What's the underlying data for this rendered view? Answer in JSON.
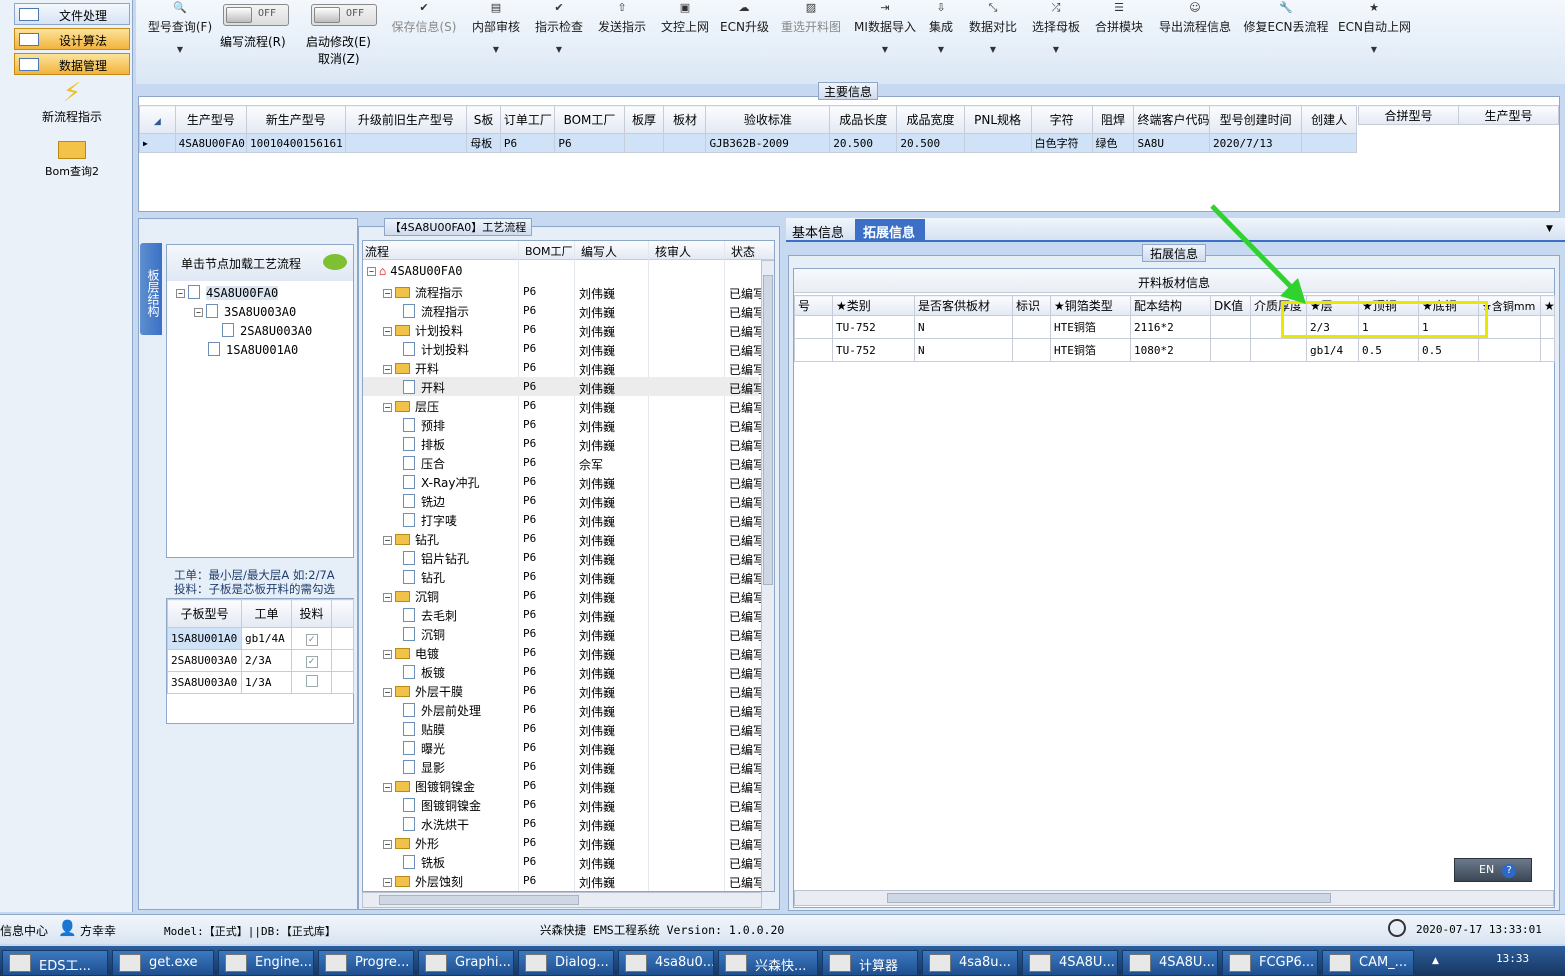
{
  "nav": {
    "items": [
      {
        "label": "文件处理"
      },
      {
        "label": "设计算法"
      },
      {
        "label": "数据管理"
      }
    ],
    "actions": [
      {
        "label": "新流程指示",
        "icon": "lightning-icon"
      },
      {
        "label": "Bom查询2",
        "icon": "open-folder-icon"
      }
    ]
  },
  "toolbar": {
    "buttons": [
      {
        "label": "型号查询(F)",
        "icon": "search-icon"
      },
      {
        "label": "保存信息(S)",
        "icon": "check-icon"
      },
      {
        "label": "内部审核",
        "icon": "printer-icon"
      },
      {
        "label": "指示检查",
        "icon": "check-icon"
      },
      {
        "label": "发送指示",
        "icon": "upload-icon"
      },
      {
        "label": "文控上网",
        "icon": "stamp-icon"
      },
      {
        "label": "ECN升级",
        "icon": "cloud-icon"
      },
      {
        "label": "重选开料图",
        "icon": "image-icon"
      },
      {
        "label": "MI数据导入",
        "icon": "import-icon"
      },
      {
        "label": "集成",
        "icon": "download-icon"
      },
      {
        "label": "数据对比",
        "icon": "compare-icon"
      },
      {
        "label": "选择母板",
        "icon": "shuffle-icon"
      },
      {
        "label": "合拼模块",
        "icon": "list-icon"
      },
      {
        "label": "导出流程信息",
        "icon": "smile-icon"
      },
      {
        "label": "修复ECN丢流程",
        "icon": "wrench-icon"
      },
      {
        "label": "ECN自动上网",
        "icon": "star-icon"
      }
    ],
    "toggles": [
      {
        "state": "OFF",
        "label": "编写流程(R)"
      },
      {
        "state": "OFF",
        "label": "启动修改(E)",
        "sub": "取消(Z)"
      }
    ]
  },
  "main_info": {
    "title": "主要信息",
    "columns": [
      "生产型号",
      "新生产型号",
      "升级前旧生产型号",
      "S板",
      "订单工厂",
      "BOM工厂",
      "板厚",
      "板材",
      "验收标准",
      "成品长度",
      "成品宽度",
      "PNL规格",
      "字符",
      "阻焊",
      "终端客户代码",
      "型号创建时间",
      "创建人"
    ],
    "row": [
      "4SA8U00FA0",
      "10010400156161",
      "",
      "母板",
      "P6",
      "P6",
      "",
      "",
      "GJB362B-2009",
      "20.500",
      "20.500",
      "",
      "白色字符",
      "绿色",
      "SA8U",
      "2020/7/13",
      ""
    ],
    "side_columns": [
      "合拼型号",
      "生产型号"
    ]
  },
  "left": {
    "vertical_tab": "板层结构",
    "hint": "单击节点加载工艺流程",
    "tree": [
      "4SA8U00FA0",
      "3SA8U003A0",
      "2SA8U003A0",
      "1SA8U001A0"
    ],
    "note1": "工单：最小层/最大层A 如:2/7A",
    "note2": "投料：子板是芯板开料的需勾选",
    "sub_headers": [
      "子板型号",
      "工单",
      "投料"
    ],
    "sub_rows": [
      {
        "model": "1SA8U001A0",
        "order": "gb1/4A",
        "checked": true
      },
      {
        "model": "2SA8U003A0",
        "order": "2/3A",
        "checked": true
      },
      {
        "model": "3SA8U003A0",
        "order": "1/3A",
        "checked": false
      }
    ]
  },
  "flow": {
    "title": "【4SA8U00FA0】工艺流程",
    "headers": [
      "流程",
      "BOM工厂",
      "编写人",
      "核审人",
      "状态"
    ],
    "root": "4SA8U00FA0",
    "rows": [
      {
        "l": 1,
        "t": "f",
        "n": "流程指示",
        "b": "P6",
        "w": "刘伟巍",
        "s": "已编写"
      },
      {
        "l": 2,
        "t": "d",
        "n": "流程指示",
        "b": "P6",
        "w": "刘伟巍",
        "s": "已编写"
      },
      {
        "l": 1,
        "t": "f",
        "n": "计划投料",
        "b": "P6",
        "w": "刘伟巍",
        "s": "已编写"
      },
      {
        "l": 2,
        "t": "d",
        "n": "计划投料",
        "b": "P6",
        "w": "刘伟巍",
        "s": "已编写"
      },
      {
        "l": 1,
        "t": "f",
        "n": "开料",
        "b": "P6",
        "w": "刘伟巍",
        "s": "已编写"
      },
      {
        "l": 2,
        "t": "d",
        "n": "开料",
        "b": "P6",
        "w": "刘伟巍",
        "s": "已编写"
      },
      {
        "l": 1,
        "t": "f",
        "n": "层压",
        "b": "P6",
        "w": "刘伟巍",
        "s": "已编写"
      },
      {
        "l": 2,
        "t": "d",
        "n": "预排",
        "b": "P6",
        "w": "刘伟巍",
        "s": "已编写"
      },
      {
        "l": 2,
        "t": "d",
        "n": "排板",
        "b": "P6",
        "w": "刘伟巍",
        "s": "已编写"
      },
      {
        "l": 2,
        "t": "d",
        "n": "压合",
        "b": "P6",
        "w": "佘军",
        "s": "已编写"
      },
      {
        "l": 2,
        "t": "d",
        "n": "X-Ray冲孔",
        "b": "P6",
        "w": "刘伟巍",
        "s": "已编写"
      },
      {
        "l": 2,
        "t": "d",
        "n": "铣边",
        "b": "P6",
        "w": "刘伟巍",
        "s": "已编写"
      },
      {
        "l": 2,
        "t": "d",
        "n": "打字唛",
        "b": "P6",
        "w": "刘伟巍",
        "s": "已编写"
      },
      {
        "l": 1,
        "t": "f",
        "n": "钻孔",
        "b": "P6",
        "w": "刘伟巍",
        "s": "已编写"
      },
      {
        "l": 2,
        "t": "d",
        "n": "铝片钻孔",
        "b": "P6",
        "w": "刘伟巍",
        "s": "已编写"
      },
      {
        "l": 2,
        "t": "d",
        "n": "钻孔",
        "b": "P6",
        "w": "刘伟巍",
        "s": "已编写"
      },
      {
        "l": 1,
        "t": "f",
        "n": "沉铜",
        "b": "P6",
        "w": "刘伟巍",
        "s": "已编写"
      },
      {
        "l": 2,
        "t": "d",
        "n": "去毛刺",
        "b": "P6",
        "w": "刘伟巍",
        "s": "已编写"
      },
      {
        "l": 2,
        "t": "d",
        "n": "沉铜",
        "b": "P6",
        "w": "刘伟巍",
        "s": "已编写"
      },
      {
        "l": 1,
        "t": "f",
        "n": "电镀",
        "b": "P6",
        "w": "刘伟巍",
        "s": "已编写"
      },
      {
        "l": 2,
        "t": "d",
        "n": "板镀",
        "b": "P6",
        "w": "刘伟巍",
        "s": "已编写"
      },
      {
        "l": 1,
        "t": "f",
        "n": "外层干膜",
        "b": "P6",
        "w": "刘伟巍",
        "s": "已编写"
      },
      {
        "l": 2,
        "t": "d",
        "n": "外层前处理",
        "b": "P6",
        "w": "刘伟巍",
        "s": "已编写"
      },
      {
        "l": 2,
        "t": "d",
        "n": "贴膜",
        "b": "P6",
        "w": "刘伟巍",
        "s": "已编写"
      },
      {
        "l": 2,
        "t": "d",
        "n": "曝光",
        "b": "P6",
        "w": "刘伟巍",
        "s": "已编写"
      },
      {
        "l": 2,
        "t": "d",
        "n": "显影",
        "b": "P6",
        "w": "刘伟巍",
        "s": "已编写"
      },
      {
        "l": 1,
        "t": "f",
        "n": "图镀铜镍金",
        "b": "P6",
        "w": "刘伟巍",
        "s": "已编写"
      },
      {
        "l": 2,
        "t": "d",
        "n": "图镀铜镍金",
        "b": "P6",
        "w": "刘伟巍",
        "s": "已编写"
      },
      {
        "l": 2,
        "t": "d",
        "n": "水洗烘干",
        "b": "P6",
        "w": "刘伟巍",
        "s": "已编写"
      },
      {
        "l": 1,
        "t": "f",
        "n": "外形",
        "b": "P6",
        "w": "刘伟巍",
        "s": "已编写"
      },
      {
        "l": 2,
        "t": "d",
        "n": "铣板",
        "b": "P6",
        "w": "刘伟巍",
        "s": "已编写"
      },
      {
        "l": 1,
        "t": "f",
        "n": "外层蚀刻",
        "b": "P6",
        "w": "刘伟巍",
        "s": "已编写"
      }
    ]
  },
  "right": {
    "tabs": [
      "基本信息",
      "拓展信息"
    ],
    "group_title": "拓展信息",
    "grid_title": "开料板材信息",
    "headers": [
      "号",
      "★类别",
      "是否客供板材",
      "标识",
      "★铜箔类型",
      "配本结构",
      "DK值",
      "介质厚度",
      "★层",
      "★顶铜",
      "★底铜",
      "★含铜mm",
      "★"
    ],
    "rows": [
      [
        "",
        "TU-752",
        "N",
        "",
        "HTE铜箔",
        "2116*2",
        "",
        "",
        "2/3",
        "1",
        "1",
        "",
        ""
      ],
      [
        "",
        "TU-752",
        "N",
        "",
        "HTE铜箔",
        "1080*2",
        "",
        "",
        "gb1/4",
        "0.5",
        "0.5",
        "",
        ""
      ]
    ],
    "ime": "EN"
  },
  "status": {
    "left": "信息中心",
    "user": "方幸幸",
    "model": "Model:【正式】||DB:【正式库】",
    "system": "兴森快捷 EMS工程系统 Version: 1.0.0.20",
    "datetime": "2020-07-17 13:33:01"
  },
  "taskbar": {
    "items": [
      "EDS工...",
      "get.exe",
      "Engine...",
      "Progre...",
      "Graphi...",
      "Dialog...",
      "4sa8u0...",
      "兴森快...",
      "计算器",
      "4sa8u...",
      "4SA8U...",
      "4SA8U...",
      "FCGP6...",
      "CAM_..."
    ],
    "time": "13:33"
  },
  "colors": {
    "nav_selected": "#f7c14b",
    "tab_active": "#3b70c6",
    "highlight_box": "#e8e800",
    "arrow": "#2fd22f"
  }
}
